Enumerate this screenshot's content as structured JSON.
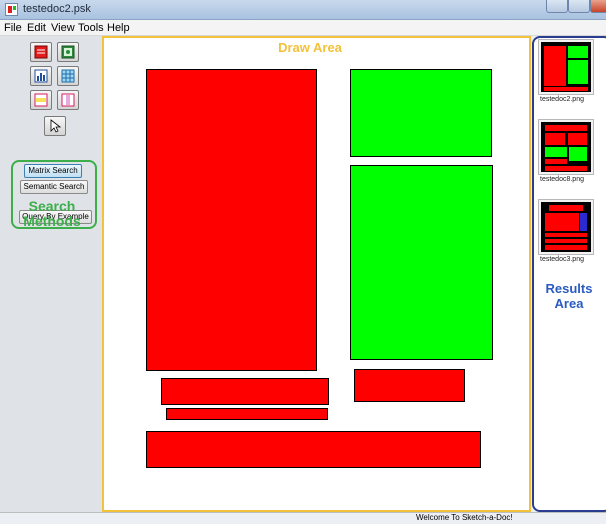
{
  "window": {
    "title": "testedoc2.psk"
  },
  "menu": [
    "File",
    "Edit",
    "View",
    "Tools",
    "Help"
  ],
  "toolbar": {
    "tools": [
      {
        "name": "rectangle-tool-icon"
      },
      {
        "name": "image-tool-icon"
      },
      {
        "name": "chart-tool-icon"
      },
      {
        "name": "table-tool-icon"
      },
      {
        "name": "horizontal-block-tool-icon"
      },
      {
        "name": "vertical-block-tool-icon"
      },
      {
        "name": "pointer-tool-icon"
      }
    ]
  },
  "search": {
    "matrix": "Matrix Search",
    "semantic": "Semantic Search",
    "qbe": "Query By Example",
    "label_line1": "Search",
    "label_line2": "Methods",
    "accent": "#3cae4a"
  },
  "draw": {
    "label": "Draw Area",
    "accent": "#f3c13a",
    "shape_colors": {
      "red": "#ff0000",
      "green": "#00ff00"
    }
  },
  "results": {
    "label_line1": "Results",
    "label_line2": "Area",
    "accent": "#2a3d8f",
    "items": [
      {
        "caption": "testedoc2.png"
      },
      {
        "caption": "testedoc8.png"
      },
      {
        "caption": "testedoc3.png"
      }
    ]
  },
  "status": {
    "message": "Welcome To Sketch-a-Doc!"
  }
}
